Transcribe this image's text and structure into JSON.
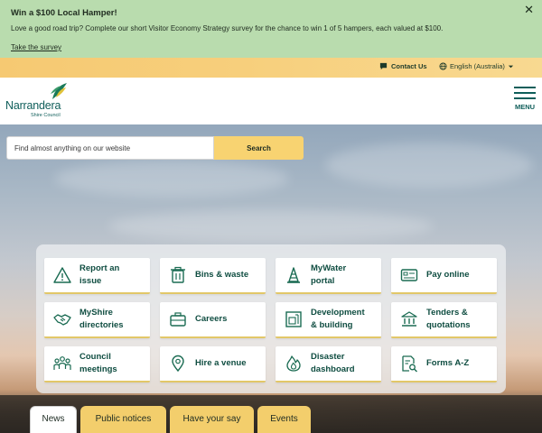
{
  "alert": {
    "title": "Win a $100 Local Hamper!",
    "text": "Love a good road trip? Complete our short Visitor Economy Strategy survey for the chance to win 1 of 5 hampers, each valued at $100.",
    "link": "Take the survey",
    "close": "✕"
  },
  "utility": {
    "contact": "Contact Us",
    "language": "English (Australia)"
  },
  "header": {
    "logo_name": "Narrandera",
    "logo_sub": "Shire Council",
    "menu_label": "MENU"
  },
  "search": {
    "placeholder": "Find almost anything on our website",
    "button": "Search"
  },
  "quick_links": [
    {
      "label1": "Report an",
      "label2": "issue",
      "icon": "warning-icon"
    },
    {
      "label1": "Bins & waste",
      "label2": "",
      "icon": "bin-icon"
    },
    {
      "label1": "MyWater",
      "label2": "portal",
      "icon": "cone-icon"
    },
    {
      "label1": "Pay online",
      "label2": "",
      "icon": "card-icon"
    },
    {
      "label1": "MyShire",
      "label2": "directories",
      "icon": "handshake-icon"
    },
    {
      "label1": "Careers",
      "label2": "",
      "icon": "briefcase-icon"
    },
    {
      "label1": "Development",
      "label2": "& building",
      "icon": "blueprint-icon"
    },
    {
      "label1": "Tenders &",
      "label2": "quotations",
      "icon": "document-icon"
    },
    {
      "label1": "Council",
      "label2": "meetings",
      "icon": "people-icon"
    },
    {
      "label1": "Hire a venue",
      "label2": "",
      "icon": "location-pin-icon"
    },
    {
      "label1": "Disaster",
      "label2": "dashboard",
      "icon": "fire-icon"
    },
    {
      "label1": "Forms A-Z",
      "label2": "",
      "icon": "form-search-icon"
    }
  ],
  "tabs": [
    {
      "label": "News",
      "active": true
    },
    {
      "label": "Public notices",
      "active": false
    },
    {
      "label": "Have your say",
      "active": false
    },
    {
      "label": "Events",
      "active": false
    }
  ],
  "colors": {
    "alert_bg": "#b9dcae",
    "accent_yellow": "#f8d371",
    "brand_green": "#0f5e5a"
  }
}
